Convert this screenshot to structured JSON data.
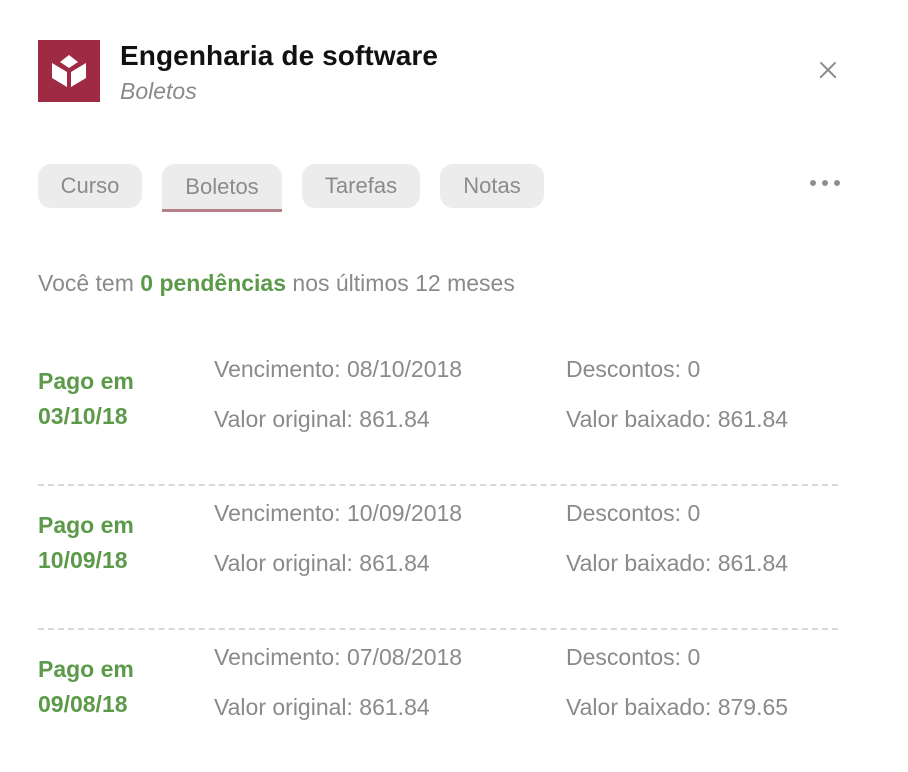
{
  "header": {
    "title": "Engenharia de software",
    "subtitle": "Boletos",
    "logo_color": "#9e2b43",
    "logo_icon": "open-book-icon",
    "close_icon": "close-icon"
  },
  "tabs": [
    {
      "label": "Curso",
      "active": false
    },
    {
      "label": "Boletos",
      "active": true
    },
    {
      "label": "Tarefas",
      "active": false
    },
    {
      "label": "Notas",
      "active": false
    }
  ],
  "more_icon": "more-horizontal-icon",
  "summary": {
    "prefix": "Você tem ",
    "count": "0 pendências",
    "suffix": " nos últimos 12 meses"
  },
  "colors": {
    "accent_green": "#5c9a4a",
    "muted_text": "#8a8a8a",
    "tab_underline": "#b6808a"
  },
  "boletos": [
    {
      "paid_label": "Pago em",
      "paid_date": "03/10/18",
      "vencimento": "Vencimento: 08/10/2018",
      "valor_original": "Valor original: 861.84",
      "descontos": "Descontos: 0",
      "valor_baixado": "Valor baixado: 861.84"
    },
    {
      "paid_label": "Pago em",
      "paid_date": "10/09/18",
      "vencimento": "Vencimento: 10/09/2018",
      "valor_original": "Valor original: 861.84",
      "descontos": "Descontos: 0",
      "valor_baixado": "Valor baixado: 861.84"
    },
    {
      "paid_label": "Pago em",
      "paid_date": "09/08/18",
      "vencimento": "Vencimento: 07/08/2018",
      "valor_original": "Valor original: 861.84",
      "descontos": "Descontos: 0",
      "valor_baixado": "Valor baixado: 879.65"
    }
  ]
}
